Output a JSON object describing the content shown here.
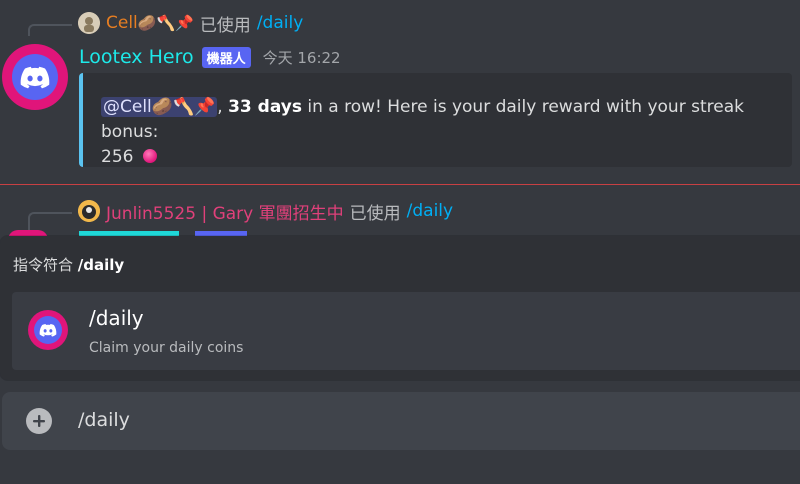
{
  "message1": {
    "reply": {
      "user": "Cell",
      "user_emojis": "🥔🪓📌",
      "user_color": "#e67e22",
      "used_label": "已使用",
      "command": "/daily"
    },
    "author": "Lootex Hero",
    "bot_tag": "機器人",
    "timestamp": "今天 16:22",
    "embed": {
      "mention": "@Cell🥔🪓📌",
      "comma": ",",
      "days_bold": "33 days",
      "text_rest": "in a row! Here is your daily reward with your streak bonus:",
      "amount": "256",
      "accent_color": "#5bc3f0"
    }
  },
  "message2": {
    "reply": {
      "user": "Junlin5525 | Gary 軍團招生中",
      "user_color": "#e0407a",
      "used_label": "已使用",
      "command": "/daily"
    }
  },
  "autocomplete": {
    "header_prefix": "指令符合",
    "header_query": "/daily",
    "items": [
      {
        "name": "/daily",
        "description": "Claim your daily coins",
        "icon": "discord-icon"
      }
    ]
  },
  "composer": {
    "value": "/daily",
    "attach_icon": "plus-icon"
  }
}
